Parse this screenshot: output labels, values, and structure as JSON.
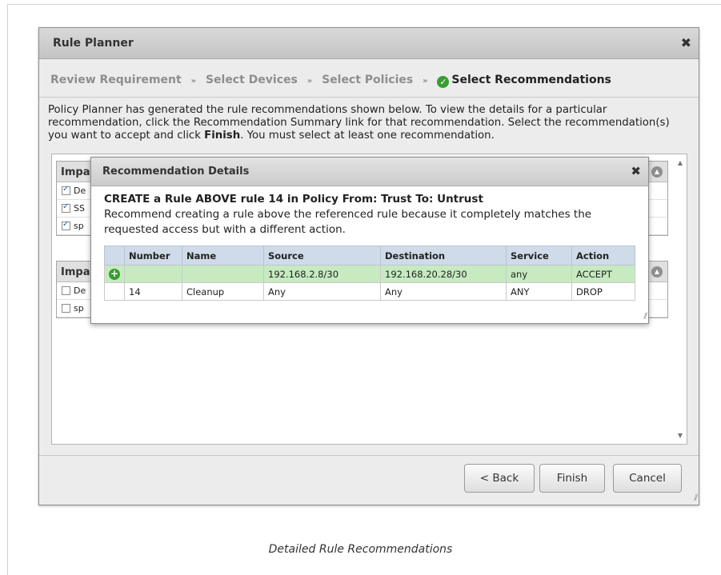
{
  "dialog": {
    "title": "Rule Planner",
    "close_glyph": "✖",
    "steps": [
      {
        "label": "Review Requirement",
        "active": false
      },
      {
        "label": "Select Devices",
        "active": false
      },
      {
        "label": "Select Policies",
        "active": false
      },
      {
        "label": "Select Recommendations",
        "active": true
      }
    ],
    "step_separator": "»",
    "description_parts": {
      "before": "Policy Planner has generated the rule recommendations shown below. To view the details for a particular recommendation, click the Recommendation Summary link for that recommendation. Select the recommendation(s) you want to accept and click ",
      "bold": "Finish",
      "after": ". You must select at least one recommendation."
    },
    "groups": [
      {
        "header": "Impa",
        "rows": [
          {
            "checked": true,
            "text": "De"
          },
          {
            "checked": true,
            "text": "SS"
          },
          {
            "checked": true,
            "text": "sp"
          }
        ]
      },
      {
        "header": "Impa",
        "rows": [
          {
            "checked": false,
            "text": "De"
          },
          {
            "checked": false,
            "text": "sp"
          }
        ]
      }
    ],
    "buttons": {
      "back": "< Back",
      "finish": "Finish",
      "cancel": "Cancel"
    }
  },
  "popup": {
    "title": "Recommendation Details",
    "close_glyph": "✖",
    "heading": "CREATE a Rule ABOVE rule 14 in Policy From: Trust To: Untrust",
    "text": "Recommend creating a rule above the referenced rule because it completely matches the requested access but with a different action.",
    "columns": [
      "",
      "Number",
      "Name",
      "Source",
      "Destination",
      "Service",
      "Action"
    ],
    "rows": [
      {
        "icon": "+",
        "number": "",
        "name": "",
        "source": "192.168.2.8/30",
        "destination": "192.168.20.28/30",
        "service": "any",
        "action": "ACCEPT",
        "recommended": true
      },
      {
        "icon": "",
        "number": "14",
        "name": "Cleanup",
        "source": "Any",
        "destination": "Any",
        "service": "ANY",
        "action": "DROP",
        "recommended": false
      }
    ]
  },
  "caption": "Detailed Rule Recommendations",
  "colors": {
    "accent_green": "#3a9c31",
    "header_blue": "#cfdbe9",
    "recommended_row": "#c7eac1"
  }
}
